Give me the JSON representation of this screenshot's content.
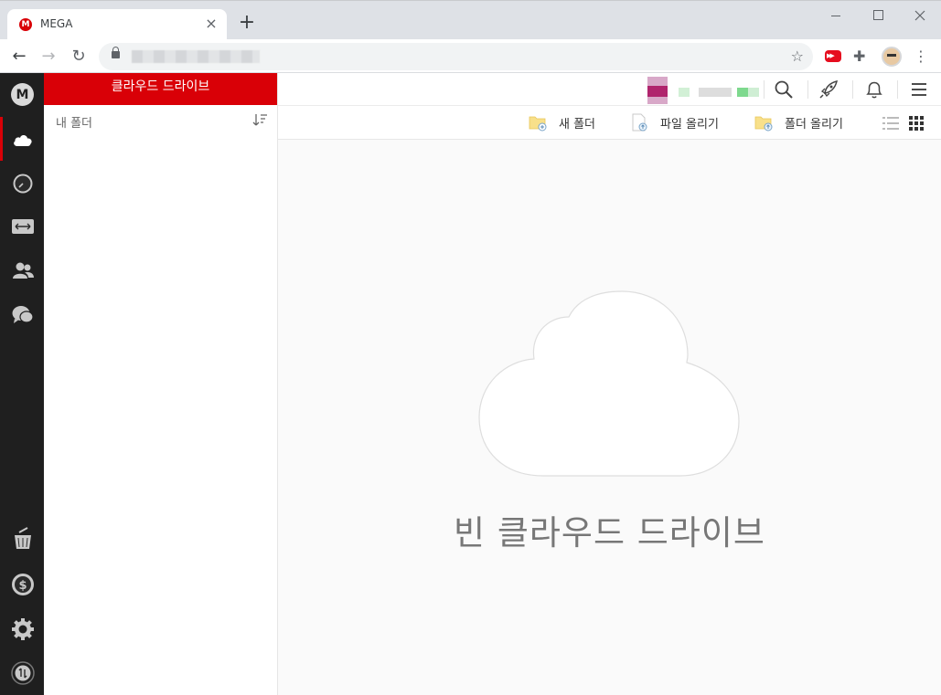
{
  "browser": {
    "tab_title": "MEGA",
    "tab_favicon": "M",
    "tab_close": "×",
    "new_tab": "+",
    "nav": {
      "back": "←",
      "forward": "→",
      "reload": "↻"
    },
    "star": "☆",
    "extensions_icon": "✚",
    "menu": "⋮"
  },
  "app": {
    "logo_letter": "M",
    "side_header": "클라우드 드라이브",
    "my_folder": "내 폴더",
    "actions": {
      "new_folder": "새 폴더",
      "upload_file": "파일 올리기",
      "upload_folder": "폴더 올리기"
    },
    "empty_label": "빈 클라우드 드라이브",
    "colors": {
      "brand_red": "#d90007",
      "leftbar_bg": "#1f1f1f"
    }
  }
}
